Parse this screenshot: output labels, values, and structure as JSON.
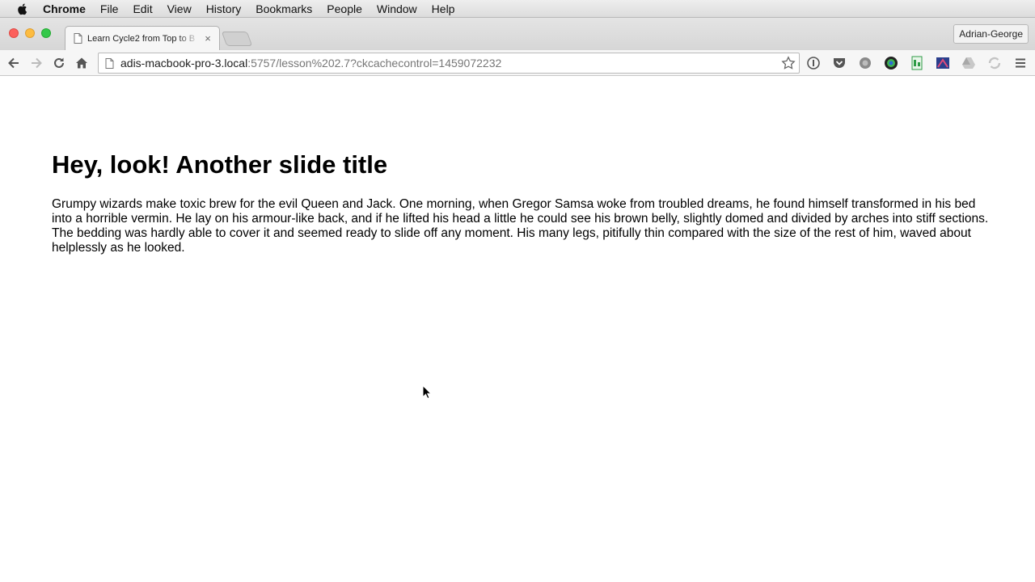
{
  "menubar": {
    "app_name": "Chrome",
    "items": [
      "File",
      "Edit",
      "View",
      "History",
      "Bookmarks",
      "People",
      "Window",
      "Help"
    ]
  },
  "tab": {
    "title": "Learn Cycle2 from Top to B",
    "close_glyph": "×"
  },
  "profile": {
    "name": "Adrian-George"
  },
  "address": {
    "host": "adis-macbook-pro-3.local",
    "path": ":5757/lesson%202.7?ckcachecontrol=1459072232"
  },
  "slide": {
    "title": "Hey, look! Another slide title",
    "body": "Grumpy wizards make toxic brew for the evil Queen and Jack. One morning, when Gregor Samsa woke from troubled dreams, he found himself transformed in his bed into a horrible vermin. He lay on his armour-like back, and if he lifted his head a little he could see his brown belly, slightly domed and divided by arches into stiff sections. The bedding was hardly able to cover it and seemed ready to slide off any moment. His many legs, pitifully thin compared with the size of the rest of him, waved about helplessly as he looked."
  },
  "colors": {
    "close": "#fc605c",
    "minimize": "#fdbc40",
    "maximize": "#34c84a"
  },
  "icons": [
    "apple-icon",
    "document-icon",
    "back-icon",
    "forward-icon",
    "reload-icon",
    "home-icon",
    "star-icon",
    "info-icon",
    "pocket-icon",
    "extension-icon",
    "color-picker-icon",
    "sheets-icon",
    "speed-icon",
    "drive-icon",
    "sync-icon",
    "menu-icon",
    "cursor-icon"
  ]
}
